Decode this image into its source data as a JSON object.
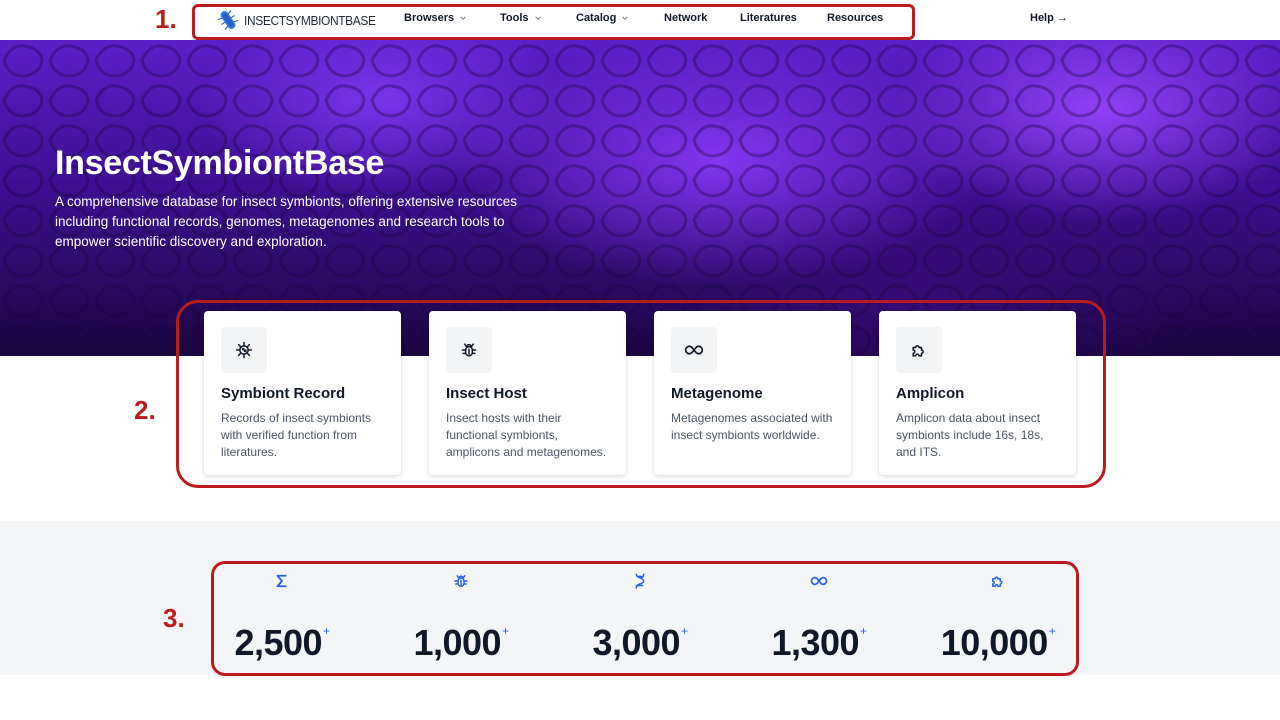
{
  "nav": {
    "brand": "INSECTSYMBIONTBASE",
    "items": [
      {
        "label": "Browsers",
        "has_dropdown": true
      },
      {
        "label": "Tools",
        "has_dropdown": true
      },
      {
        "label": "Catalog",
        "has_dropdown": true
      },
      {
        "label": "Network",
        "has_dropdown": false
      },
      {
        "label": "Literatures",
        "has_dropdown": false
      },
      {
        "label": "Resources",
        "has_dropdown": false
      }
    ],
    "help_label": "Help",
    "help_arrow": "→"
  },
  "hero": {
    "title": "InsectSymbiontBase",
    "description": "A comprehensive database for insect symbionts, offering extensive resources including functional records, genomes, metagenomes and research tools to empower scientific discovery and exploration."
  },
  "cards": [
    {
      "icon": "virus-icon",
      "title": "Symbiont Record",
      "description": "Records of insect symbionts with verified function from literatures."
    },
    {
      "icon": "bug-icon",
      "title": "Insect Host",
      "description": "Insect hosts with their functional symbionts, amplicons and metagenomes."
    },
    {
      "icon": "infinity-icon",
      "title": "Metagenome",
      "description": "Metagenomes associated with insect symbionts worldwide."
    },
    {
      "icon": "puzzle-icon",
      "title": "Amplicon",
      "description": "Amplicon data about insect symbionts include 16s, 18s, and ITS."
    }
  ],
  "stats": [
    {
      "icon": "sigma-icon",
      "value": "2,500",
      "suffix": "+"
    },
    {
      "icon": "bug-icon",
      "value": "1,000",
      "suffix": "+"
    },
    {
      "icon": "dna-icon",
      "value": "3,000",
      "suffix": "+"
    },
    {
      "icon": "infinity-icon",
      "value": "1,300",
      "suffix": "+"
    },
    {
      "icon": "puzzle-icon",
      "value": "10,000",
      "suffix": "+"
    }
  ],
  "annotations": [
    "1.",
    "2.",
    "3."
  ],
  "colors": {
    "accent": "#2563eb",
    "annotation": "#b91c1c",
    "hero": "#4c1bb0"
  }
}
